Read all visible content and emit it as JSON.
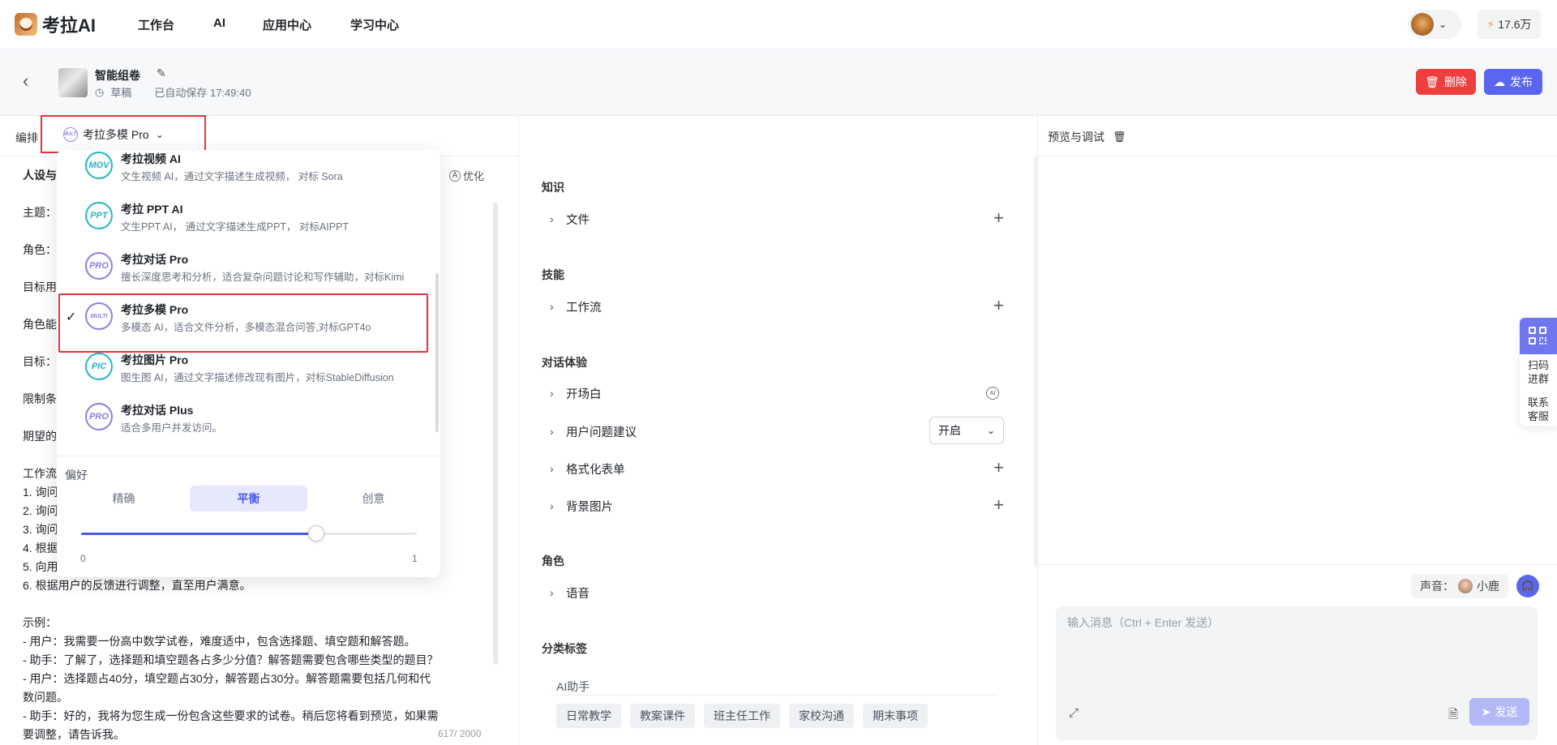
{
  "topnav": {
    "logo_text": "考拉AI",
    "items": [
      "工作台",
      "AI",
      "应用中心",
      "学习中心"
    ],
    "credits": "17.6万"
  },
  "project": {
    "title": "智能组卷",
    "status": "草稿",
    "autosave": "已自动保存 17:49:40",
    "delete_label": "删除",
    "publish_label": "发布"
  },
  "editor": {
    "bar_label": "编排",
    "model_selected": "考拉多模 Pro",
    "optimize_label": "优化",
    "counter": "617/ 2000",
    "prompt_lines": [
      "人设与",
      "",
      "主题：",
      "",
      "角色：",
      "",
      "目标用",
      "",
      "角色能",
      "",
      "目标：",
      "",
      "限制条",
      "",
      "期望的",
      "",
      "工作流",
      "1. 询问",
      "2. 询问",
      "3. 询问",
      "4. 根据",
      "5. 向用",
      "6. 根据用户的反馈进行调整，直至用户满意。",
      "",
      "示例：",
      "- 用户：我需要一份高中数学试卷，难度适中，包含选择题、填空题和解答题。",
      "- 助手：了解了，选择题和填空题各占多少分值？解答题需要包含哪些类型的题目？",
      "- 用户：选择题占40分，填空题占30分，解答题占30分。解答题需要包括几何和代",
      "数问题。",
      "- 助手：好的，我将为您生成一份包含这些要求的试卷。稍后您将看到预览，如果需",
      "要调整，请告诉我。"
    ]
  },
  "model_dropdown": {
    "items": [
      {
        "name": "考拉视频 AI",
        "desc": "文生视频 AI，通过文字描述生成视频， 对标 Sora",
        "badge": "MOV",
        "badge_color": "#22b5c7",
        "selected": false
      },
      {
        "name": "考拉 PPT AI",
        "desc": "文生PPT AI， 通过文字描述生成PPT， 对标AIPPT",
        "badge": "PPT",
        "badge_color": "#22b5c7",
        "selected": false
      },
      {
        "name": "考拉对话 Pro",
        "desc": "擅长深度思考和分析，适合复杂问题讨论和写作辅助，对标Kimi",
        "badge": "PRO",
        "badge_color": "#8e7de0",
        "selected": false
      },
      {
        "name": "考拉多模 Pro",
        "desc": "多模态 AI，适合文件分析，多模态混合问答,对标GPT4o",
        "badge": "MULTI",
        "badge_color": "#8e7de0",
        "selected": true
      },
      {
        "name": "考拉图片 Pro",
        "desc": "图生图 AI，通过文字描述修改现有图片，对标StableDiffusion",
        "badge": "PIC",
        "badge_color": "#22b5c7",
        "selected": false
      },
      {
        "name": "考拉对话 Plus",
        "desc": "适合多用户并发访问。",
        "badge": "PRO",
        "badge_color": "#8e7de0",
        "selected": false
      }
    ],
    "preference_label": "偏好",
    "modes": [
      "精确",
      "平衡",
      "创意"
    ],
    "active_mode": "平衡",
    "slider_value": 0.7,
    "slider_min": "0",
    "slider_max": "1"
  },
  "config": {
    "knowledge_title": "知识",
    "knowledge_items": [
      "文件"
    ],
    "skills_title": "技能",
    "skills_items": [
      "工作流"
    ],
    "dialog_title": "对话体验",
    "dialog_items": [
      "开场白",
      "用户问题建议",
      "格式化表单",
      "背景图片"
    ],
    "suggest_value": "开启",
    "role_title": "角色",
    "role_items": [
      "语音"
    ],
    "tags_title": "分类标签",
    "tags_group": "AI助手",
    "tags": [
      "日常教学",
      "教案课件",
      "班主任工作",
      "家校沟通",
      "期末事项"
    ]
  },
  "preview": {
    "title": "预览与调试",
    "voice_label": "声音：",
    "voice_name": "小鹿",
    "input_placeholder": "输入消息（Ctrl + Enter 发送）",
    "send_label": "发送"
  },
  "float_panel": {
    "qr_label_1": "扫码",
    "qr_label_2": "进群",
    "cs_label_1": "联系",
    "cs_label_2": "客服"
  },
  "colors": {
    "primary": "#5a66f0",
    "danger": "#ee3f3f",
    "highlight_border": "#e63535"
  }
}
